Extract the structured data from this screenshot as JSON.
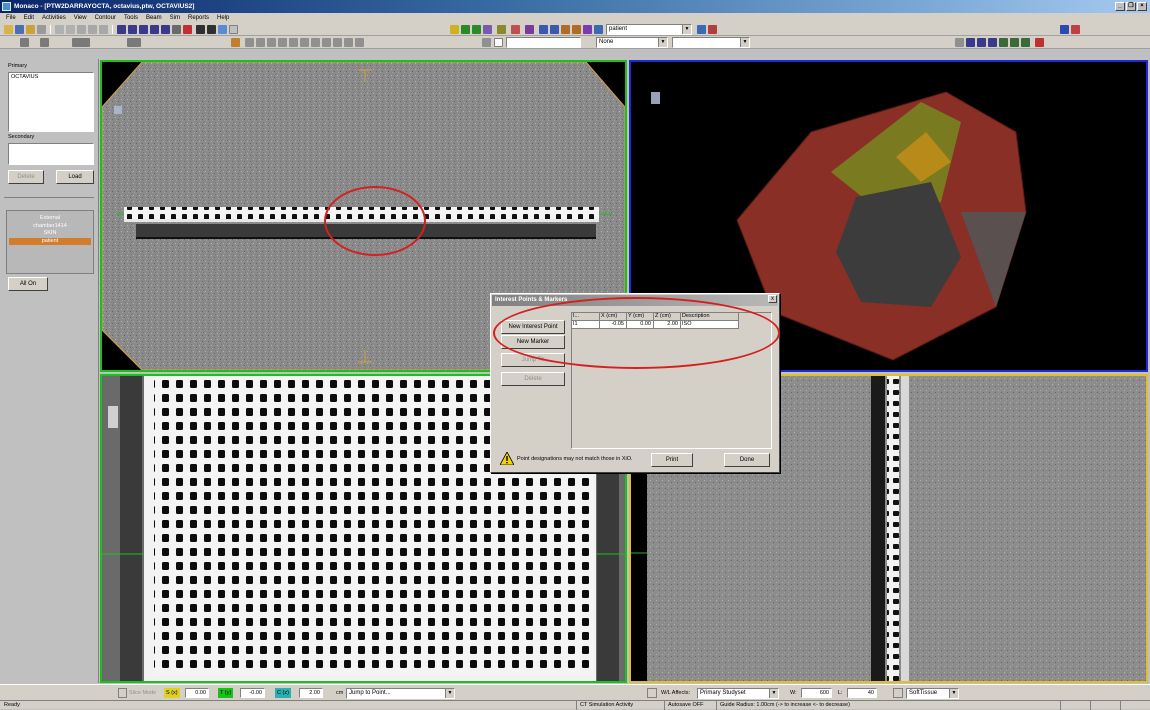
{
  "window": {
    "title": "Monaco - [PTW2DARRAYOCTA, octavius,ptw, OCTAVIUS2]"
  },
  "menu": [
    "File",
    "Edit",
    "Activities",
    "View",
    "Contour",
    "Tools",
    "Beam",
    "Sim",
    "Reports",
    "Help"
  ],
  "toolbar": {
    "structure_combo": "patient",
    "tb2_combo_a": "None"
  },
  "left_panel": {
    "primary_label": "Primary",
    "primary_items": [
      "OCTAVIUS"
    ],
    "secondary_label": "Secondary",
    "delete_button": "Delete",
    "load_button": "Load",
    "structures": [
      "External",
      "chamber1414",
      "SKIN"
    ],
    "selected_structure": "patient",
    "all_on_button": "All On"
  },
  "dialog": {
    "title": "Interest Points & Markers",
    "close": "x",
    "buttons": {
      "new_interest_point": "New Interest Point",
      "new_marker": "New Marker",
      "jump_to": "Jump To",
      "delete": "Delete",
      "print": "Print",
      "done": "Done"
    },
    "columns": [
      "I...",
      "X (cm)",
      "Y (cm)",
      "Z (cm)",
      "Description"
    ],
    "rows": [
      {
        "id": "I1",
        "x": "-0.05",
        "y": "0.00",
        "z": "2.00",
        "description": "ISO"
      }
    ],
    "warning": "Point designations may not match those in XiO."
  },
  "bottom_bar": {
    "slice_mode_label": "Slice Mode",
    "s_label": "S (x)",
    "s_value": "0.00",
    "t_label": "T (y)",
    "t_value": "-0.00",
    "c_label": "C (z)",
    "c_value": "2.00",
    "cm": "cm",
    "jump_combo": "Jump to Point...",
    "wl_affects_label": "W/L Affects:",
    "wl_affects_value": "Primary Studyset",
    "w_label": "W:",
    "w_value": "600",
    "l_label": "L:",
    "l_value": "40",
    "preset": "SoftTissue"
  },
  "status": {
    "ready": "Ready",
    "activity": "CT Simulation Activity",
    "autosave": "Autosave OFF",
    "guide": "Guide Radius: 1.00cm (-> to increase <- to decrease)"
  },
  "colors": {
    "viewport_green": "#19c219",
    "viewport_blue": "#1e2ad8",
    "viewport_yellow": "#e0c02a",
    "annotation_red": "#d42020",
    "render_body": "#8a2f25",
    "render_highlight": "#7a7a20"
  }
}
